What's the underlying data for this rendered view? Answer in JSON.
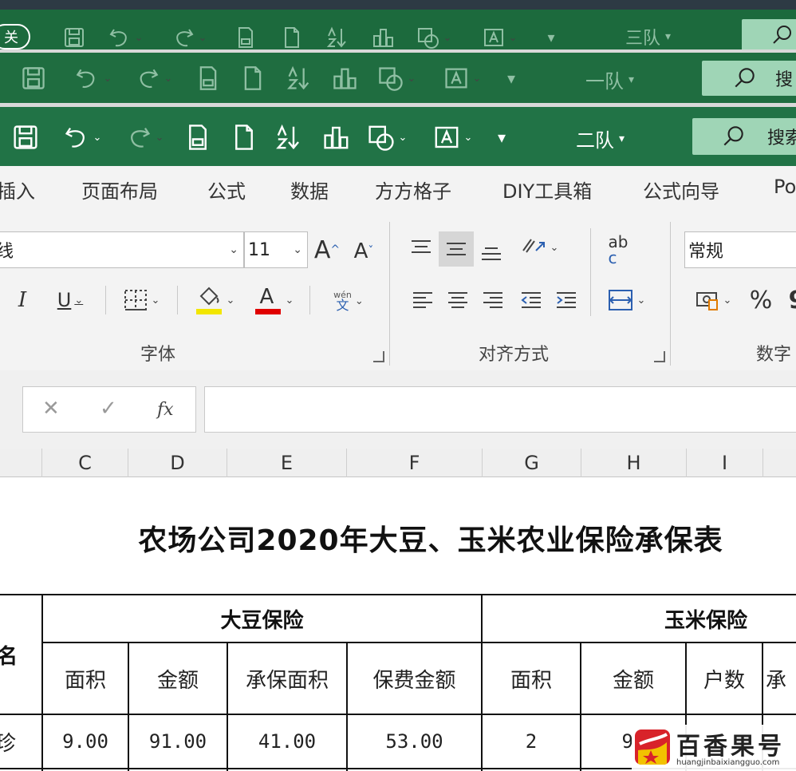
{
  "windows": [
    {
      "team": "三队",
      "close_label": "关",
      "search_label": ""
    },
    {
      "team": "一队",
      "search_label": "搜"
    },
    {
      "team": "二队",
      "search_label": "搜索"
    }
  ],
  "tabs": [
    "插入",
    "页面布局",
    "公式",
    "数据",
    "方方格子",
    "DIY工具箱",
    "公式向导",
    "Po"
  ],
  "ribbon": {
    "font_name": "线",
    "font_size": "11",
    "grow_font": "A",
    "shrink_font": "A",
    "italic": "I",
    "underline": "U",
    "font_color_glyph": "A",
    "phonetic_top": "wén",
    "phonetic_bottom": "文",
    "wrap_glyph_top": "ab",
    "wrap_glyph_bottom": "c",
    "number_format": "常规",
    "percent": "%",
    "comma": "9",
    "groups": {
      "font": "字体",
      "alignment": "对齐方式",
      "number": "数字"
    },
    "fill_color": "#f2e600",
    "font_color": "#e00000"
  },
  "formula_bar": {
    "cancel": "✕",
    "enter": "✓",
    "fx": "fx",
    "value": ""
  },
  "columns": [
    "C",
    "D",
    "E",
    "F",
    "G",
    "H",
    "I"
  ],
  "sheet": {
    "title": "农场公司2020年大豆、玉米农业保险承保表",
    "left_header": "名",
    "soy_header": "大豆保险",
    "corn_header": "玉米保险",
    "soy_cols": [
      "面积",
      "金额",
      "承保面积",
      "保费金额"
    ],
    "corn_cols": [
      "面积",
      "金额",
      "户数",
      "承"
    ],
    "row_name": "珍",
    "row_values": [
      "9.00",
      "91.00",
      "41.00",
      "53.00",
      "2",
      "91"
    ]
  },
  "watermark": {
    "text": "百香果号",
    "url": "huangjinbaixiangguo.com"
  }
}
